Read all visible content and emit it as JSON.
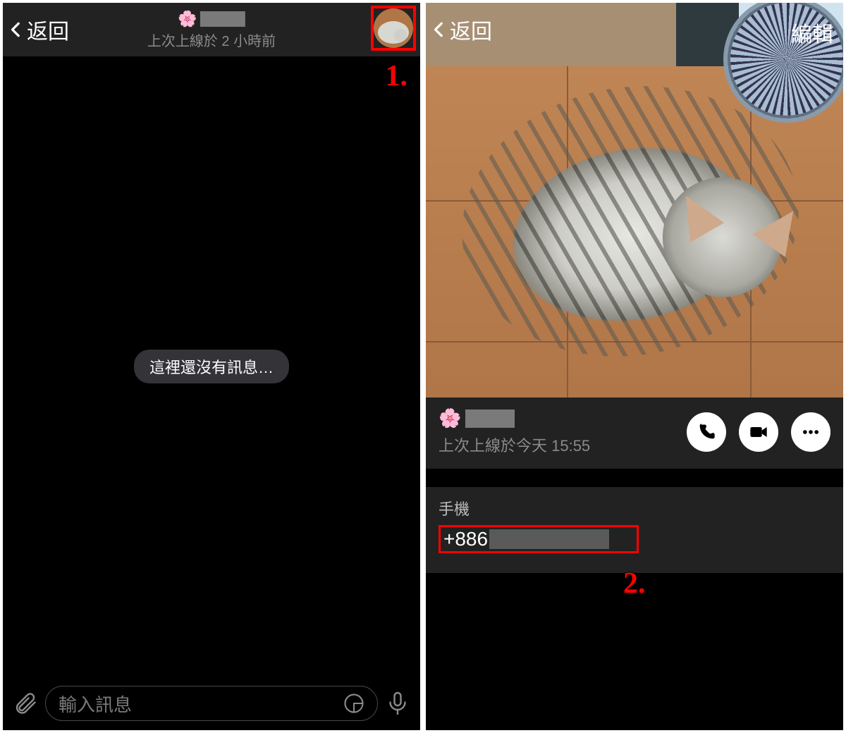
{
  "left": {
    "back_label": "返回",
    "contact_name_redacted": true,
    "last_seen": "上次上線於 2 小時前",
    "empty_msg": "這裡還沒有訊息…",
    "input_placeholder": "輸入訊息",
    "annotation": "1.",
    "flower_emoji": "🌸"
  },
  "right": {
    "back_label": "返回",
    "edit_label": "編輯",
    "last_seen": "上次上線於今天 15:55",
    "phone_label": "手機",
    "phone_prefix": "+886",
    "phone_redacted": true,
    "annotation": "2.",
    "flower_emoji": "🌸",
    "action_icons": [
      "phone-icon",
      "video-icon",
      "more-icon"
    ]
  }
}
